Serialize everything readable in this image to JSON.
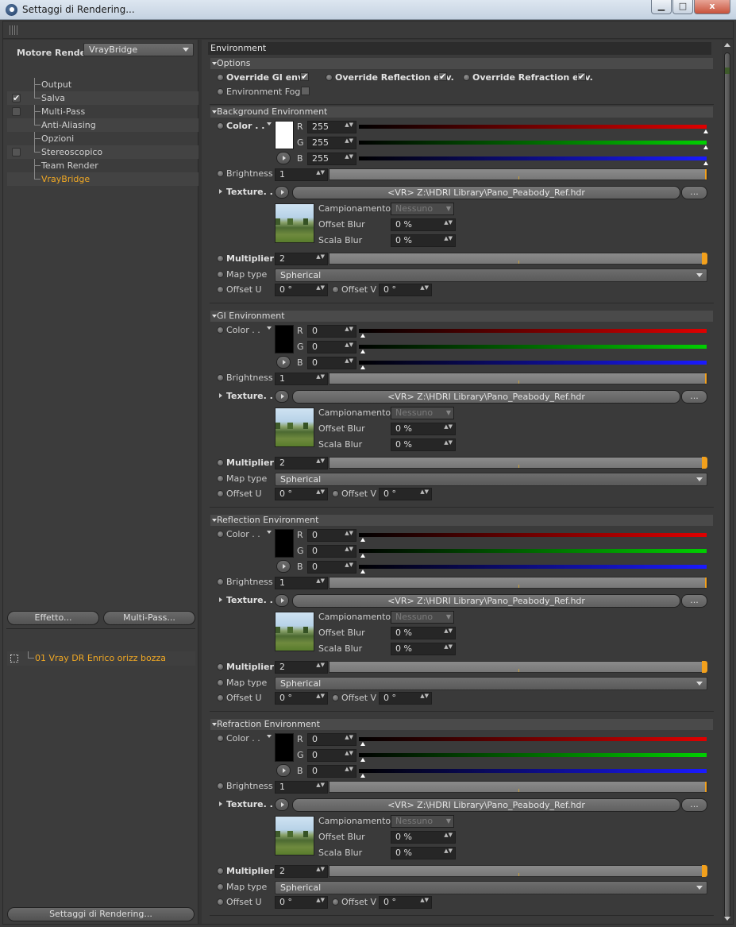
{
  "window": {
    "title": "Settaggi di Rendering...",
    "btn_min": "▁",
    "btn_max": "□",
    "btn_close": "x"
  },
  "left": {
    "renderer_label": "Motore Render",
    "renderer_value": "VrayBridge",
    "tree": [
      {
        "label": "Output",
        "check": null
      },
      {
        "label": "Salva",
        "check": "✔"
      },
      {
        "label": "Multi-Pass",
        "check": ""
      },
      {
        "label": "Anti-Aliasing",
        "check": null
      },
      {
        "label": "Opzioni",
        "check": null
      },
      {
        "label": "Stereoscopico",
        "check": ""
      },
      {
        "label": "Team Render",
        "check": null
      },
      {
        "label": "VrayBridge",
        "check": null,
        "active": true
      }
    ],
    "effect_button": "Effetto...",
    "multipass_button": "Multi-Pass...",
    "render_item": "01 Vray DR Enrico orizz bozza",
    "bottom_button": "Settaggi di Rendering..."
  },
  "right": {
    "header": "Environment",
    "options": {
      "title": "Options",
      "override_gi": "Override GI env.",
      "override_reflection": "Override Reflection env.",
      "override_refraction": "Override Refraction env.",
      "environment_fog": "Environment Fog",
      "check_mark": "✔"
    },
    "labels": {
      "color": "Color . .",
      "r": "R",
      "g": "G",
      "b": "B",
      "brightness": "Brightness",
      "texture": "Texture. . .",
      "campionamento": "Campionamento",
      "offset_blur": "Offset Blur",
      "scala_blur": "Scala Blur",
      "multiplier": "Multiplier",
      "map_type": "Map type",
      "offset_u": "Offset U",
      "offset_v": "Offset V",
      "dots": "...",
      "spin": "▲▼"
    },
    "sections": [
      {
        "title": "Background Environment",
        "color_hex": "#ffffff",
        "r": "255",
        "g": "255",
        "b": "255",
        "rgb_level": 1.0,
        "brightness": "1",
        "texture_path": "<VR>  Z:\\HDRI Library\\Pano_Peabody_Ref.hdr",
        "campionamento": "Nessuno",
        "offset_blur": "0 %",
        "scala_blur": "0 %",
        "multiplier": "2",
        "map_type": "Spherical",
        "offset_u": "0 °",
        "offset_v": "0 °"
      },
      {
        "title": "GI Environment",
        "color_hex": "#000000",
        "r": "0",
        "g": "0",
        "b": "0",
        "rgb_level": 0.0,
        "brightness": "1",
        "texture_path": "<VR>  Z:\\HDRI Library\\Pano_Peabody_Ref.hdr",
        "campionamento": "Nessuno",
        "offset_blur": "0 %",
        "scala_blur": "0 %",
        "multiplier": "2",
        "map_type": "Spherical",
        "offset_u": "0 °",
        "offset_v": "0 °"
      },
      {
        "title": "Reflection Environment",
        "color_hex": "#000000",
        "r": "0",
        "g": "0",
        "b": "0",
        "rgb_level": 0.0,
        "brightness": "1",
        "texture_path": "<VR>  Z:\\HDRI Library\\Pano_Peabody_Ref.hdr",
        "campionamento": "Nessuno",
        "offset_blur": "0 %",
        "scala_blur": "0 %",
        "multiplier": "2",
        "map_type": "Spherical",
        "offset_u": "0 °",
        "offset_v": "0 °"
      },
      {
        "title": "Refraction Environment",
        "color_hex": "#000000",
        "r": "0",
        "g": "0",
        "b": "0",
        "rgb_level": 0.0,
        "brightness": "1",
        "texture_path": "<VR>  Z:\\HDRI Library\\Pano_Peabody_Ref.hdr",
        "campionamento": "Nessuno",
        "offset_blur": "0 %",
        "scala_blur": "0 %",
        "multiplier": "2",
        "map_type": "Spherical",
        "offset_u": "0 °",
        "offset_v": "0 °"
      }
    ]
  }
}
